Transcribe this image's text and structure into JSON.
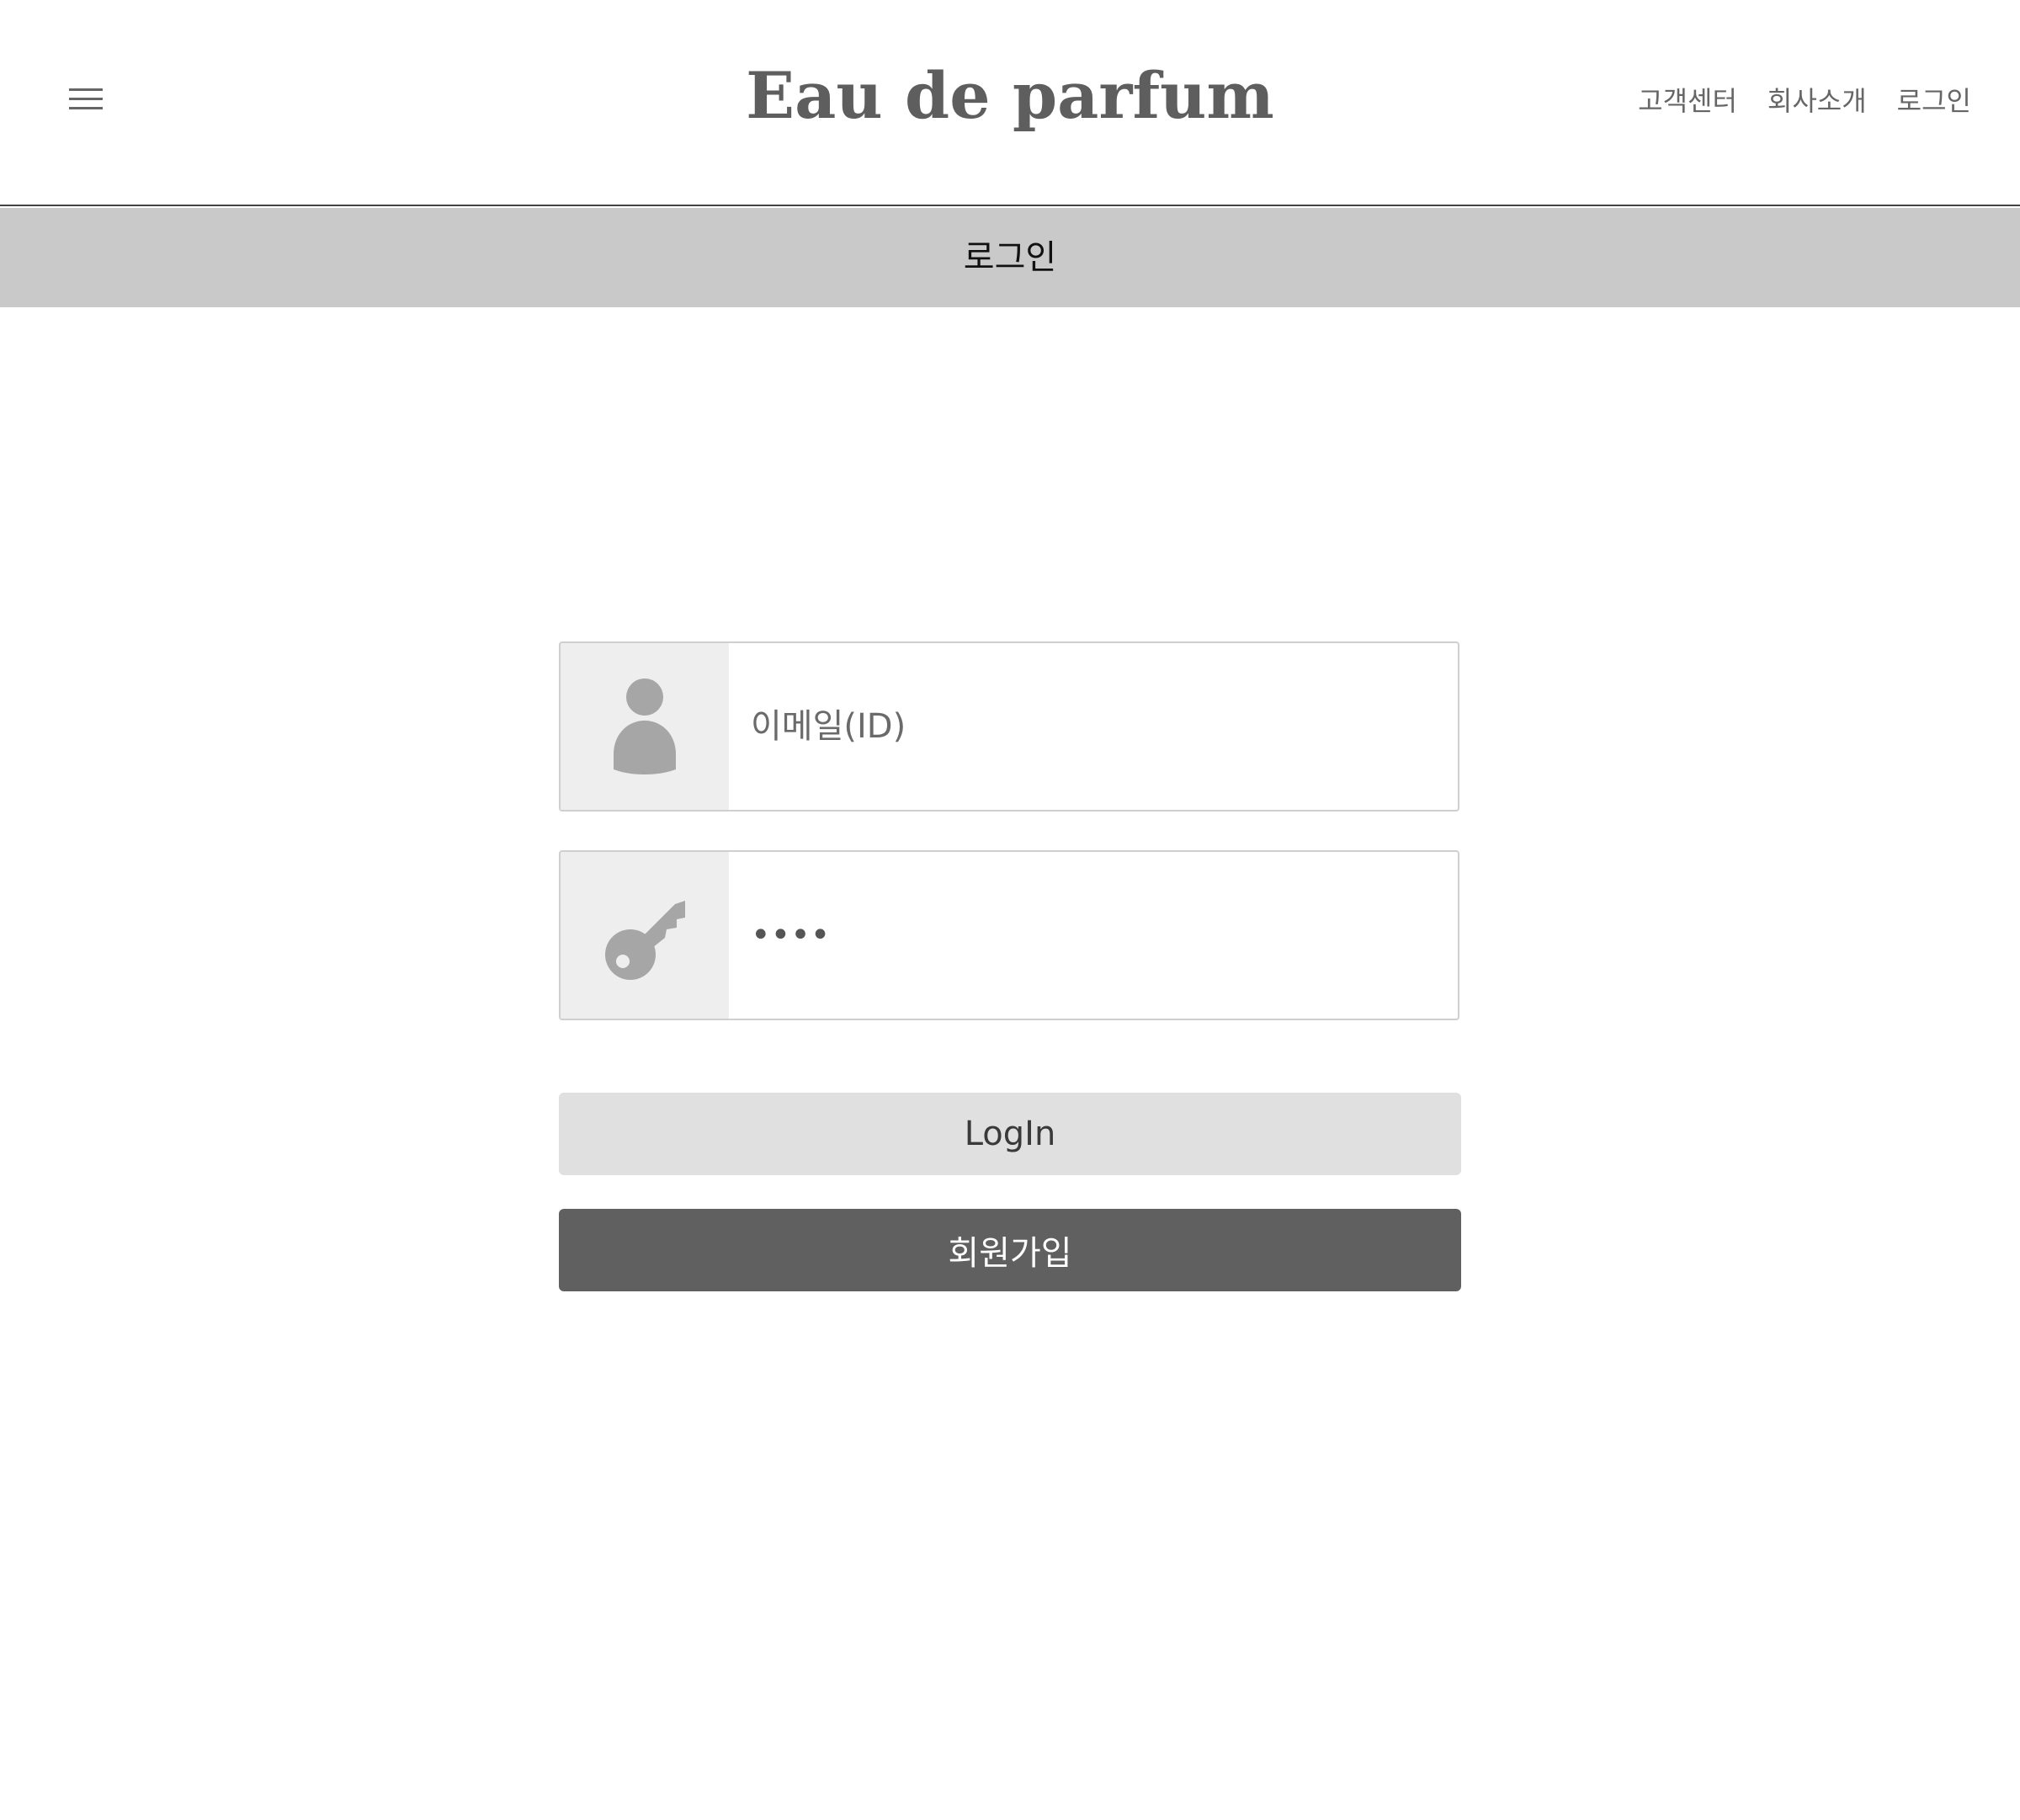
{
  "header": {
    "brand": "Eau de parfum",
    "menu_icon": "hamburger-menu-icon",
    "nav": [
      {
        "label": "고객센터"
      },
      {
        "label": "회사소개"
      },
      {
        "label": "로그인"
      }
    ]
  },
  "page": {
    "title": "로그인"
  },
  "form": {
    "email": {
      "icon": "user-icon",
      "placeholder": "이메일(ID)",
      "value": ""
    },
    "password": {
      "icon": "key-icon",
      "value": "1234"
    },
    "login_label": "LogIn",
    "signup_label": "회원가입"
  },
  "colors": {
    "brand": "#5e5e5e",
    "title_bar_bg": "#c9c9c9",
    "login_button_bg": "#e0e0e0",
    "signup_button_bg": "#606060",
    "icon_gray": "#a6a6a6"
  }
}
